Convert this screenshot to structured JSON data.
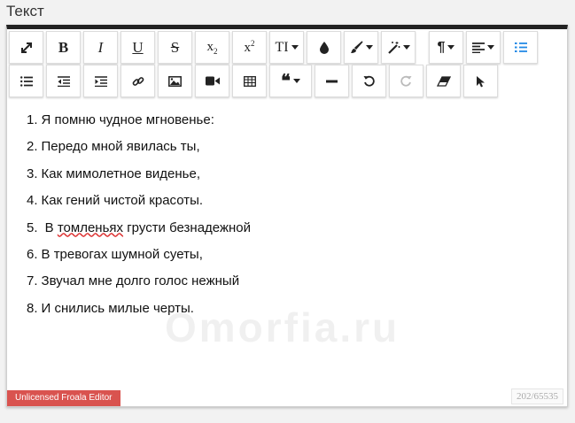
{
  "field": {
    "label": "Текст"
  },
  "toolbar": {
    "row1": [
      {
        "name": "fullscreen-button",
        "icon": "expand-icon"
      },
      {
        "name": "bold-button",
        "icon": "bold-icon",
        "text": "B"
      },
      {
        "name": "italic-button",
        "icon": "italic-icon",
        "text": "I"
      },
      {
        "name": "underline-button",
        "icon": "underline-icon",
        "text": "U"
      },
      {
        "name": "strikethrough-button",
        "icon": "strikethrough-icon",
        "text": "S"
      },
      {
        "name": "subscript-button",
        "icon": "subscript-icon",
        "text": "x"
      },
      {
        "name": "superscript-button",
        "icon": "superscript-icon",
        "text": "x"
      },
      {
        "name": "font-size-button",
        "icon": "text-size-icon",
        "text": "TI"
      },
      {
        "name": "color-button",
        "icon": "droplet-icon"
      },
      {
        "name": "paint-style-button",
        "icon": "paint-brush-icon"
      },
      {
        "name": "magic-style-button",
        "icon": "magic-wand-icon"
      },
      {
        "name": "paragraph-format-button",
        "icon": "pilcrow-icon",
        "text": "¶"
      },
      {
        "name": "align-button",
        "icon": "align-left-icon"
      },
      {
        "name": "ordered-list-button",
        "icon": "ordered-list-icon"
      }
    ],
    "row2": [
      {
        "name": "unordered-list-button",
        "icon": "unordered-list-icon"
      },
      {
        "name": "outdent-button",
        "icon": "outdent-icon"
      },
      {
        "name": "indent-button",
        "icon": "indent-icon"
      },
      {
        "name": "insert-link-button",
        "icon": "link-icon"
      },
      {
        "name": "insert-image-button",
        "icon": "image-icon"
      },
      {
        "name": "insert-video-button",
        "icon": "video-camera-icon"
      },
      {
        "name": "insert-table-button",
        "icon": "table-icon"
      },
      {
        "name": "quote-button",
        "icon": "quote-icon"
      },
      {
        "name": "horizontal-line-button",
        "icon": "minus-icon"
      },
      {
        "name": "undo-button",
        "icon": "undo-icon"
      },
      {
        "name": "redo-button",
        "icon": "redo-icon",
        "disabled": true
      },
      {
        "name": "clear-formatting-button",
        "icon": "eraser-icon"
      },
      {
        "name": "select-all-button",
        "icon": "cursor-pointer-icon"
      }
    ]
  },
  "content": {
    "lines": [
      {
        "num": "1.",
        "text": "Я помню чудное мгновенье:"
      },
      {
        "num": "2.",
        "text": "Передо мной явилась ты,"
      },
      {
        "num": "3.",
        "text": "Как мимолетное виденье,"
      },
      {
        "num": "4.",
        "text": "Как гений чистой красоты."
      },
      {
        "num": "5.",
        "pre": " В ",
        "misspelled": "томленьях",
        "post": " грусти безнадежной"
      },
      {
        "num": "6.",
        "text": "В тревогах шумной суеты,"
      },
      {
        "num": "7.",
        "text": "Звучал мне долго голос нежный"
      },
      {
        "num": "8.",
        "text": "И снились милые черты."
      }
    ]
  },
  "watermark": "Omorfia.ru",
  "footer": {
    "license": "Unlicensed Froala Editor",
    "counter": "202/65535"
  },
  "colors": {
    "accent": "#1e88e5",
    "license_bg": "#d9534f",
    "top_border": "#222222"
  }
}
